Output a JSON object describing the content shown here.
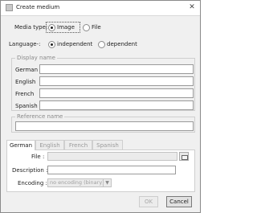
{
  "window": {
    "title": "Create medium",
    "app_icon": "medium-icon",
    "close_glyph": "✕"
  },
  "media_type": {
    "label": "Media type:",
    "options": [
      "Image",
      "File"
    ],
    "selected": "Image"
  },
  "language": {
    "label": "Language-:",
    "options": [
      "independent",
      "dependent"
    ],
    "selected": "independent"
  },
  "display_name": {
    "legend": "Display name",
    "rows": [
      {
        "label": "German",
        "value": ""
      },
      {
        "label": "English",
        "value": ""
      },
      {
        "label": "French",
        "value": ""
      },
      {
        "label": "Spanish",
        "value": ""
      }
    ]
  },
  "reference_name": {
    "legend": "Reference name",
    "value": ""
  },
  "tabs": {
    "items": [
      "German",
      "English",
      "French",
      "Spanish"
    ],
    "active": "German"
  },
  "tab_panel": {
    "file_label": "File :",
    "file_value": "",
    "browse_icon": "folder-icon",
    "description_label": "Description :",
    "description_value": "",
    "encoding_label": "Encoding :",
    "encoding_value": "no encoding (binary)"
  },
  "buttons": {
    "ok": "OK",
    "cancel": "Cancel"
  }
}
